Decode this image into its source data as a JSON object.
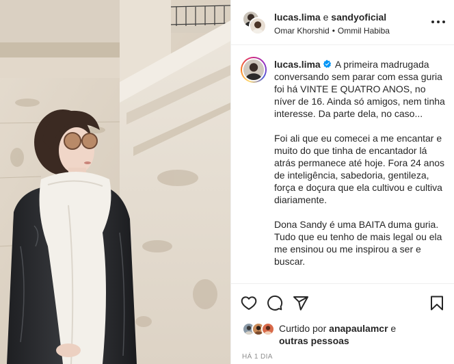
{
  "header": {
    "author_1": "lucas.lima",
    "conjunction": "e",
    "author_2": "sandyoficial",
    "subtitle_1": "Omar Khorshid",
    "separator": "•",
    "subtitle_2": "Ommil Habiba",
    "more_icon": "more-horizontal-icon"
  },
  "caption": {
    "username": "lucas.lima",
    "verified_icon": "verified-badge-icon",
    "paragraphs": [
      "A primeira madrugada conversando sem parar com essa guria foi há VINTE E QUATRO ANOS, no níver de 16. Ainda só amigos, nem tinha interesse. Da parte dela, no caso...",
      "Foi ali que eu comecei a me encantar e muito do que tinha de encantador lá atrás permanece até hoje. Fora 24 anos de inteligência, sabedoria, gentileza, força e doçura que ela cultivou e cultiva diariamente.",
      "Dona Sandy é uma BAITA duma guria. Tudo que eu tenho de mais legal ou ela me ensinou ou me inspirou a ser e buscar."
    ]
  },
  "actions": {
    "like_icon": "heart-icon",
    "comment_icon": "comment-icon",
    "share_icon": "share-icon",
    "save_icon": "bookmark-icon"
  },
  "likes": {
    "prefix": "Curtido por",
    "liker": "anapaulamcr",
    "conjunction": "e",
    "others": "outras pessoas"
  },
  "timestamp": "HÁ 1 DIA",
  "colors": {
    "text": "#262626",
    "secondary": "#8e8e8e",
    "border": "#efefef",
    "verified": "#0095f6"
  }
}
